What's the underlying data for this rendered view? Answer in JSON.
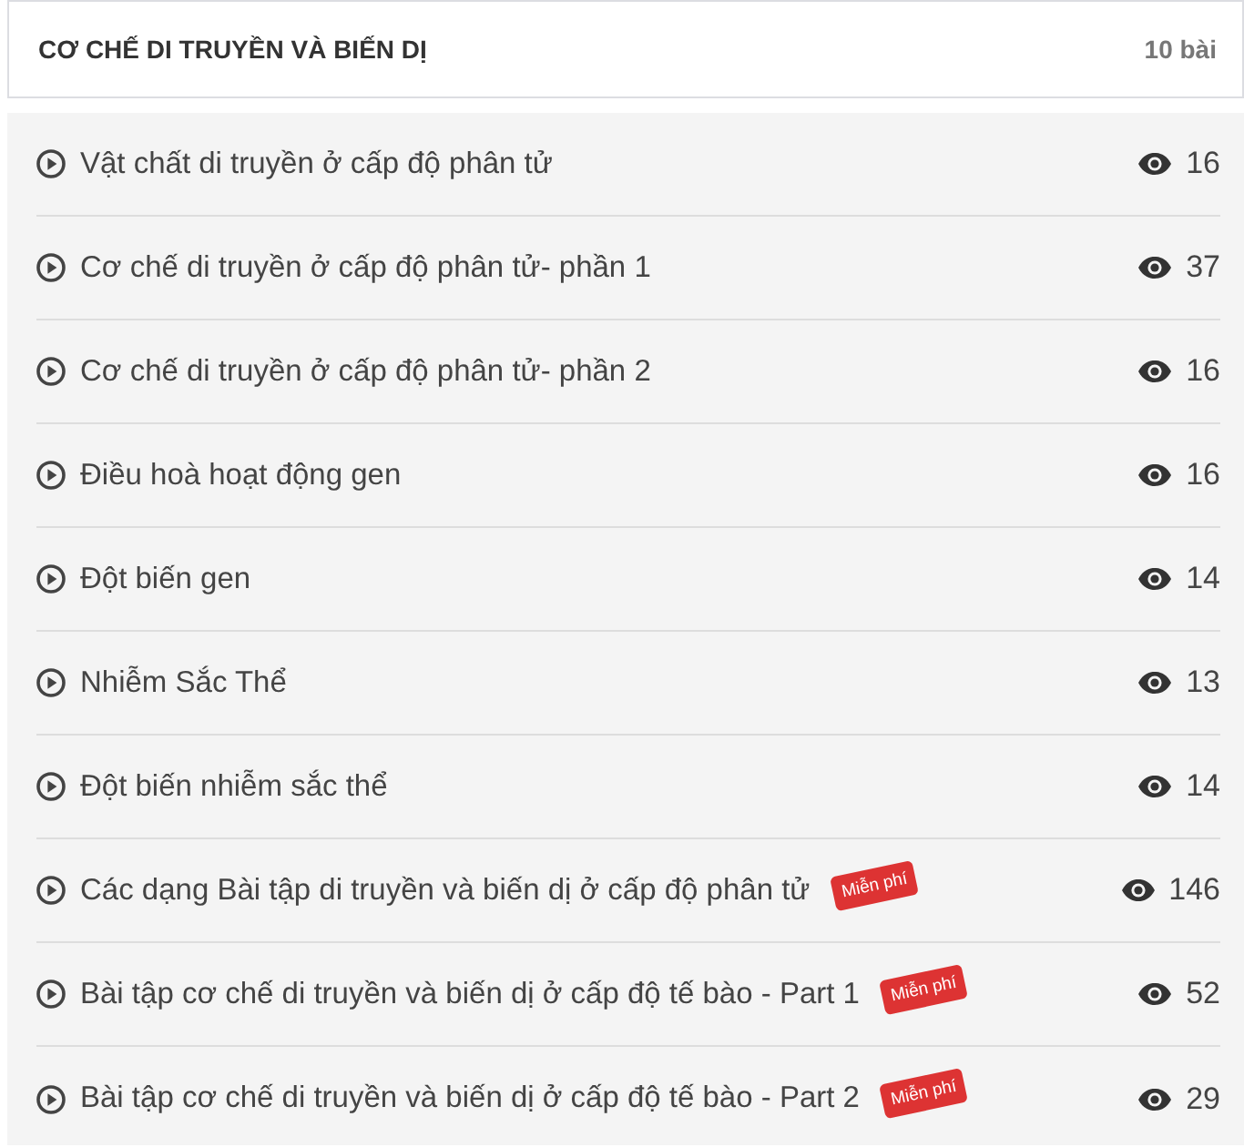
{
  "section": {
    "title": "CƠ CHẾ DI TRUYỀN VÀ BIẾN DỊ",
    "count": "10 bài"
  },
  "lessons": [
    {
      "title": "Vật chất di truyền ở cấp độ phân tử",
      "views": "16"
    },
    {
      "title": "Cơ chế di truyền ở cấp độ phân tử- phần 1",
      "views": "37"
    },
    {
      "title": "Cơ chế di truyền ở cấp độ phân tử- phần 2",
      "views": "16"
    },
    {
      "title": "Điều hoà hoạt động gen",
      "views": "16"
    },
    {
      "title": "Đột biến gen",
      "views": "14"
    },
    {
      "title": "Nhiễm Sắc Thể",
      "views": "13"
    },
    {
      "title": "Đột biến nhiễm sắc thể",
      "views": "14"
    },
    {
      "title": "Các dạng Bài tập di truyền và biến dị ở cấp độ phân tử",
      "badge": "Miễn phí",
      "views": "146"
    },
    {
      "title": "Bài tập cơ chế di truyền và biến dị ở cấp độ tế bào - Part 1",
      "badge": "Miễn phí",
      "views": "52"
    },
    {
      "title": "Bài tập cơ chế di truyền và biến dị ở cấp độ tế bào - Part 2",
      "badge": "Miễn phí",
      "views": "29"
    }
  ]
}
